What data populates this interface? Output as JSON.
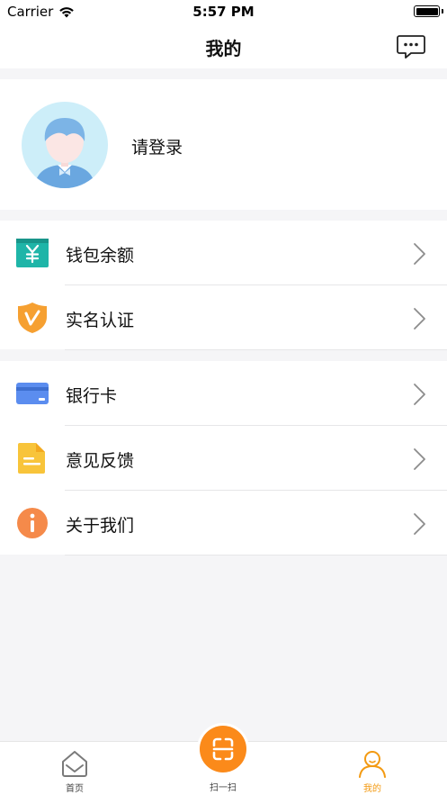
{
  "status_bar": {
    "carrier": "Carrier",
    "time": "5:57 PM"
  },
  "nav": {
    "title": "我的"
  },
  "profile": {
    "login_prompt": "请登录"
  },
  "menu_group_1": [
    {
      "label": "钱包余额",
      "icon": "wallet-icon",
      "color": "#1fb5a8"
    },
    {
      "label": "实名认证",
      "icon": "shield-v-icon",
      "color": "#f6a031"
    }
  ],
  "menu_group_2": [
    {
      "label": "银行卡",
      "icon": "bank-card-icon",
      "color": "#5b8def"
    },
    {
      "label": "意见反馈",
      "icon": "document-icon",
      "color": "#f8c43a"
    },
    {
      "label": "关于我们",
      "icon": "info-icon",
      "color": "#f58a4a"
    }
  ],
  "tab_bar": {
    "home_label": "首页",
    "scan_label": "扫一扫",
    "mine_label": "我的",
    "active_color": "#f39a12"
  }
}
